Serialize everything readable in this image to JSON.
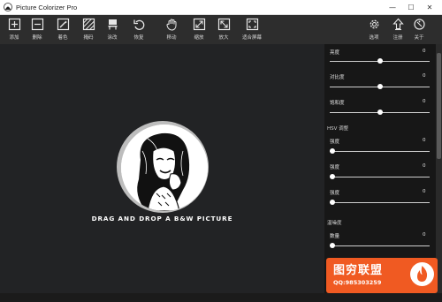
{
  "window": {
    "title": "Picture Colorizer Pro",
    "minimize": "—",
    "maximize": "☐",
    "close": "✕"
  },
  "toolbar": {
    "add": "添加",
    "remove": "删除",
    "colorize": "着色",
    "mask": "掩码",
    "erase": "涂改",
    "restore": "恢复",
    "move": "移动",
    "zoom": "缩放",
    "enlarge": "放大",
    "fit_screen": "适合屏幕",
    "options": "选项",
    "register": "注册",
    "about": "关于"
  },
  "canvas": {
    "drop_text": "DRAG AND DROP A B&W PICTURE"
  },
  "panel": {
    "brightness": {
      "label": "亮度",
      "value": "0",
      "level": 0.5
    },
    "contrast": {
      "label": "对比度",
      "value": "0",
      "level": 0.5
    },
    "saturation": {
      "label": "饱和度",
      "value": "0",
      "level": 0.5
    },
    "hsv_title": "HSV 调整",
    "hsv1": {
      "label": "强度",
      "value": "0",
      "level": 0.0
    },
    "hsv2": {
      "label": "强度",
      "value": "0",
      "level": 0.0
    },
    "hsv3": {
      "label": "强度",
      "value": "0",
      "level": 0.0
    },
    "noise_title": "温噪度",
    "amount": {
      "label": "数量",
      "value": "0",
      "level": 0.0
    },
    "partial": {
      "value": "0"
    }
  },
  "watermark": {
    "main": "图穷联盟",
    "sub": "QQ:985303259"
  },
  "colors": {
    "toolbar_bg": "#2d2d2d",
    "canvas_bg": "#222325",
    "panel_bg": "#171717",
    "watermark": "#f05a22"
  }
}
